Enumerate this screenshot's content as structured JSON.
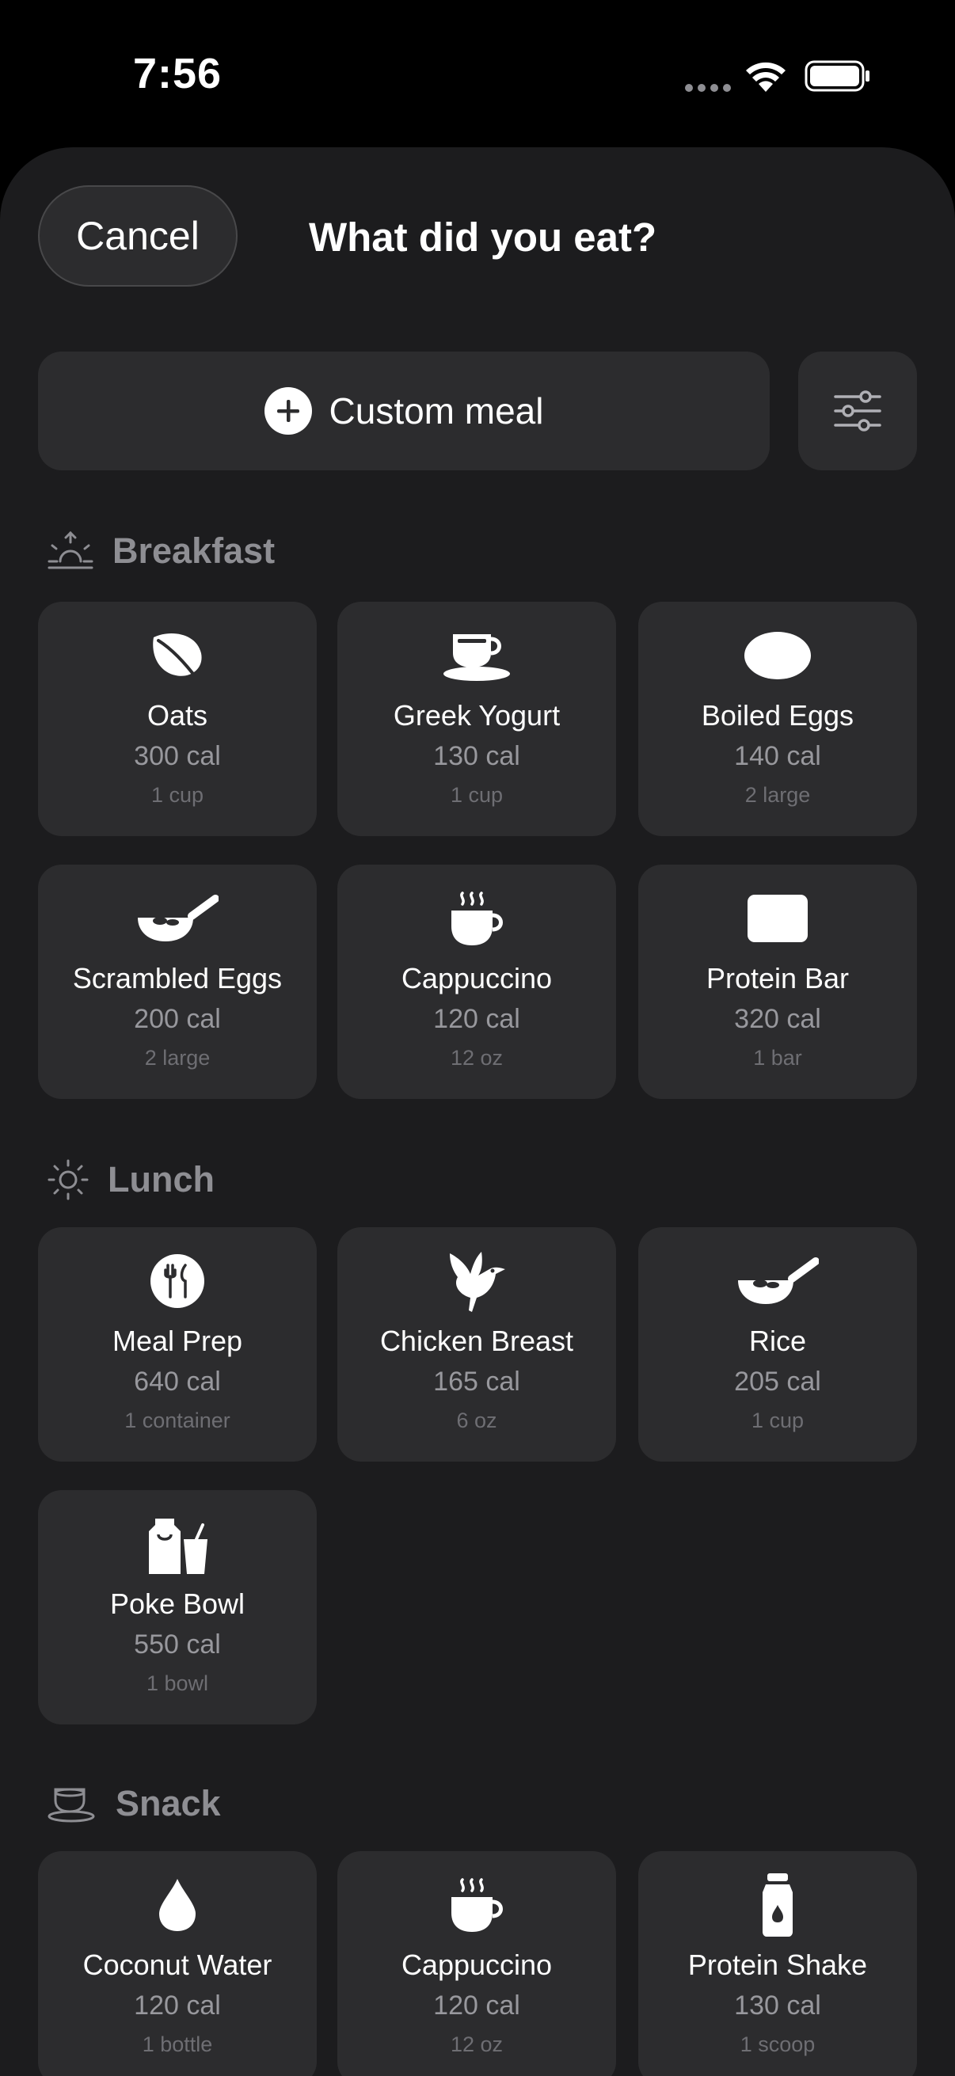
{
  "status_bar": {
    "time": "7:56"
  },
  "header": {
    "cancel_label": "Cancel",
    "title": "What did you eat?"
  },
  "actions": {
    "custom_meal_label": "Custom meal"
  },
  "sections": [
    {
      "title": "Breakfast",
      "icon": "sunrise-icon",
      "items": [
        {
          "name": "Oats",
          "calories": "300 cal",
          "portion": "1 cup",
          "icon": "leaf-icon"
        },
        {
          "name": "Greek Yogurt",
          "calories": "130 cal",
          "portion": "1 cup",
          "icon": "cup-and-saucer-icon"
        },
        {
          "name": "Boiled Eggs",
          "calories": "140 cal",
          "portion": "2 large",
          "icon": "egg-icon"
        },
        {
          "name": "Scrambled Eggs",
          "calories": "200 cal",
          "portion": "2 large",
          "icon": "frying-pan-icon"
        },
        {
          "name": "Cappuccino",
          "calories": "120 cal",
          "portion": "12 oz",
          "icon": "hot-cup-icon"
        },
        {
          "name": "Protein Bar",
          "calories": "320 cal",
          "portion": "1 bar",
          "icon": "bar-icon"
        }
      ]
    },
    {
      "title": "Lunch",
      "icon": "sun-icon",
      "items": [
        {
          "name": "Meal Prep",
          "calories": "640 cal",
          "portion": "1 container",
          "icon": "fork-knife-icon"
        },
        {
          "name": "Chicken Breast",
          "calories": "165 cal",
          "portion": "6 oz",
          "icon": "bird-icon"
        },
        {
          "name": "Rice",
          "calories": "205 cal",
          "portion": "1 cup",
          "icon": "frying-pan-icon"
        },
        {
          "name": "Poke Bowl",
          "calories": "550 cal",
          "portion": "1 bowl",
          "icon": "takeout-bag-icon"
        }
      ]
    },
    {
      "title": "Snack",
      "icon": "cup-and-saucer-icon",
      "items": [
        {
          "name": "Coconut Water",
          "calories": "120 cal",
          "portion": "1 bottle",
          "icon": "drop-icon"
        },
        {
          "name": "Cappuccino",
          "calories": "120 cal",
          "portion": "12 oz",
          "icon": "hot-cup-icon"
        },
        {
          "name": "Protein Shake",
          "calories": "130 cal",
          "portion": "1 scoop",
          "icon": "shaker-bottle-icon"
        }
      ]
    }
  ],
  "colors": {
    "background": "#000000",
    "sheet": "#1c1c1e",
    "card": "#2c2c2e",
    "secondary_text": "#8e8e93"
  }
}
